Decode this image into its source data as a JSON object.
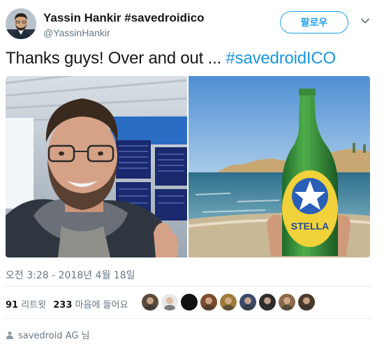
{
  "author": {
    "name": "Yassin Hankir #savedroidico",
    "handle": "@YassinHankir"
  },
  "follow_button": {
    "label": "팔로우"
  },
  "tweet": {
    "text": "Thanks guys! Over and out ...",
    "hashtag": "#savedroidICO"
  },
  "media": {
    "left_photo": "selfie-airport",
    "right_photo": "bottle-beach",
    "bottle_label": "STELLA"
  },
  "timestamp": "오전 3:28 - 2018년 4월 18일",
  "stats": {
    "retweets_count": "91",
    "retweets_label": "리트윗",
    "likes_count": "233",
    "likes_label": "마음에 들어요"
  },
  "likers": [
    {
      "color": "#5b4a3a"
    },
    {
      "color": "#e8e8e8"
    },
    {
      "color": "#111111"
    },
    {
      "color": "#7a4b2a"
    },
    {
      "color": "#a07a3a"
    },
    {
      "color": "#3b4a6b"
    },
    {
      "color": "#2c2c2c"
    },
    {
      "color": "#8a6a4a"
    },
    {
      "color": "#4a3a2a"
    }
  ],
  "footer": {
    "text": "savedroid AG 님"
  },
  "colors": {
    "accent": "#1da1f2",
    "hashtag": "#1b95e0",
    "muted": "#657786"
  }
}
